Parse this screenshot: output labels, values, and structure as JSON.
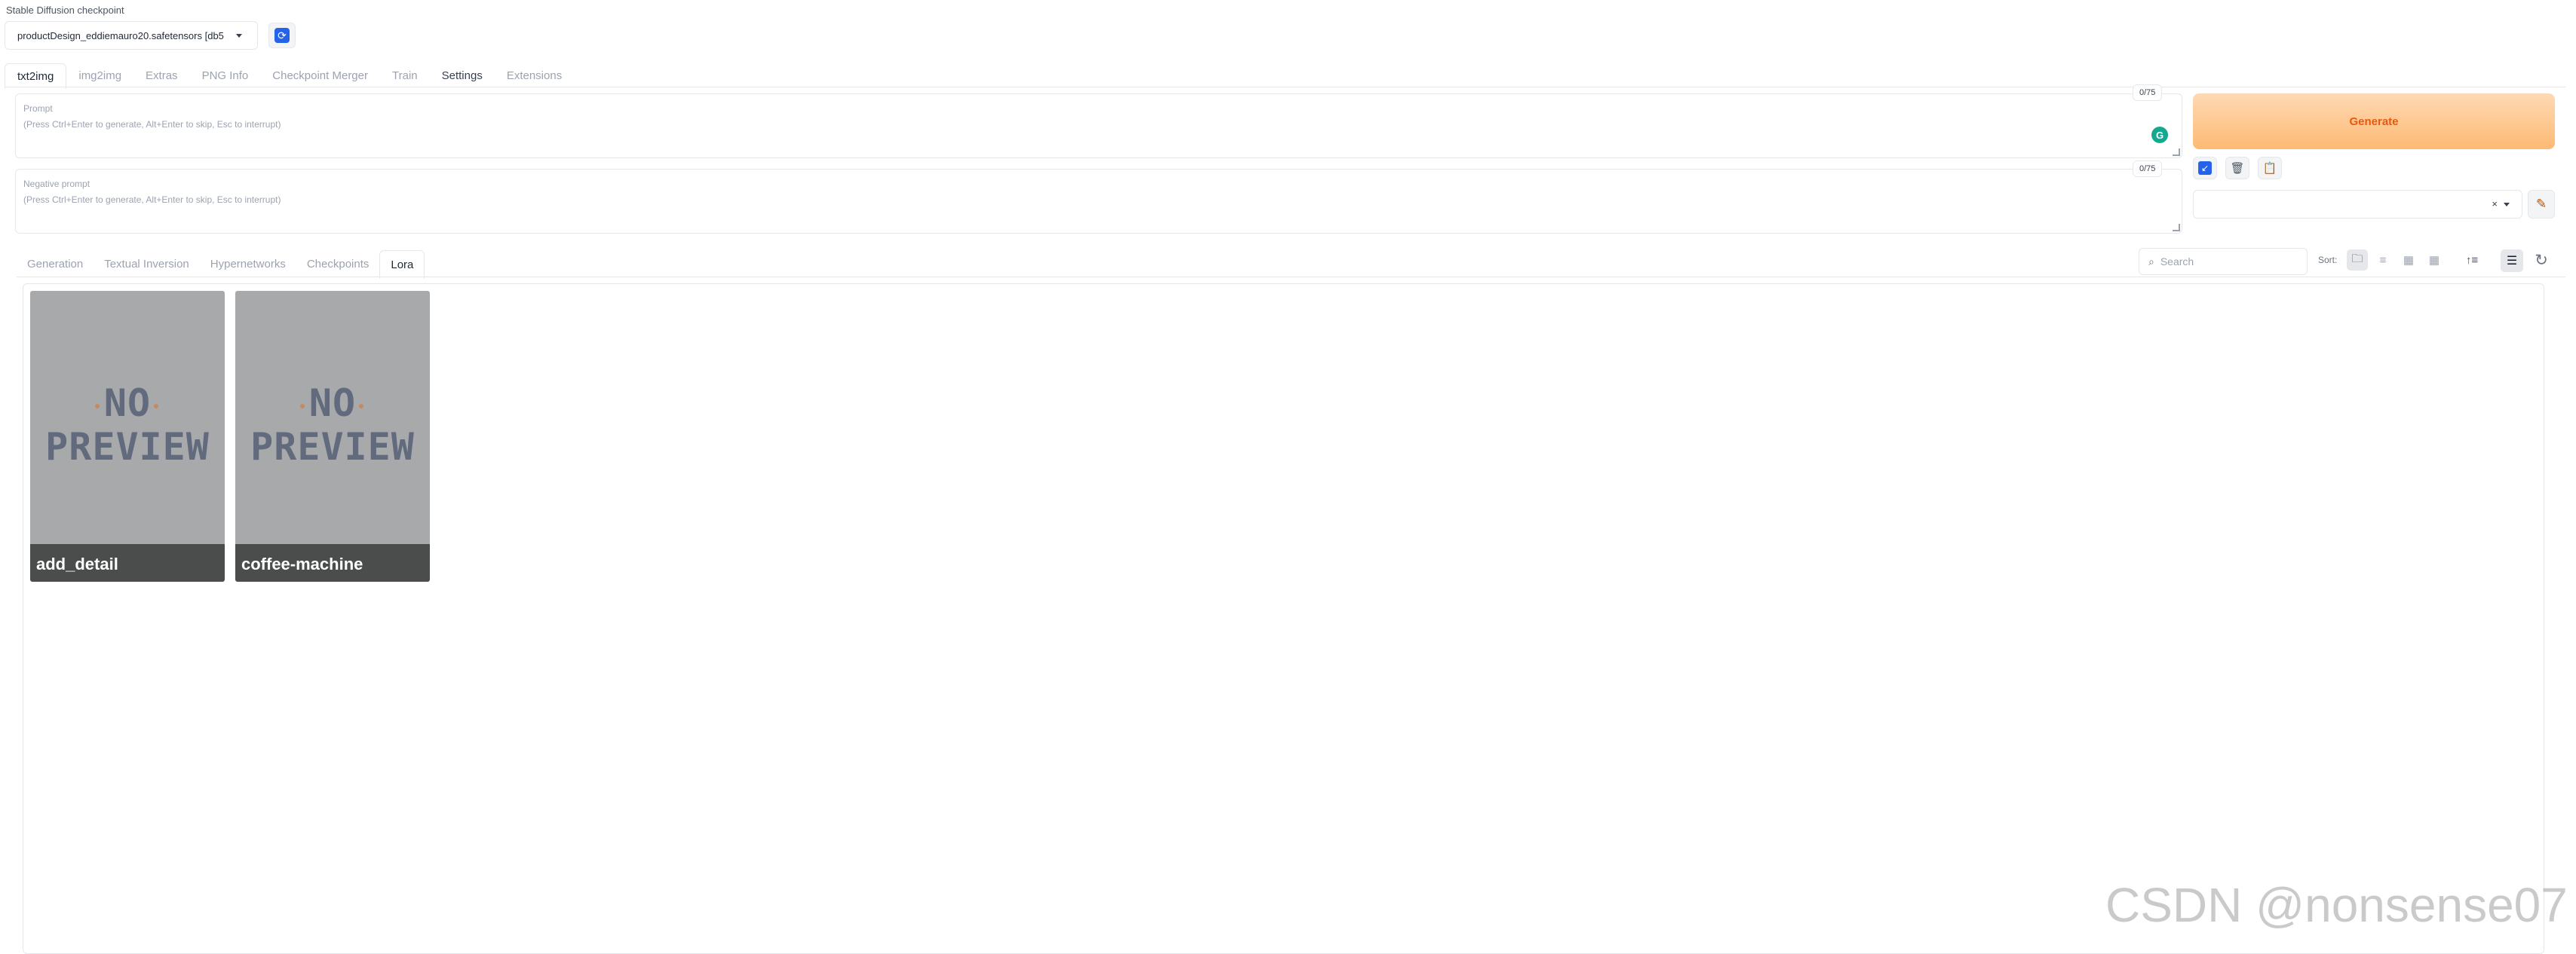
{
  "checkpoint": {
    "label": "Stable Diffusion checkpoint",
    "value": "productDesign_eddiemauro20.safetensors [db5"
  },
  "top_tabs": [
    {
      "label": "txt2img",
      "selected": true
    },
    {
      "label": "img2img"
    },
    {
      "label": "Extras"
    },
    {
      "label": "PNG Info"
    },
    {
      "label": "Checkpoint Merger"
    },
    {
      "label": "Train"
    },
    {
      "label": "Settings"
    },
    {
      "label": "Extensions"
    }
  ],
  "prompt": {
    "label": "Prompt",
    "placeholder": "(Press Ctrl+Enter to generate, Alt+Enter to skip, Esc to interrupt)",
    "token_count": "0/75"
  },
  "negative_prompt": {
    "label": "Negative prompt",
    "placeholder": "(Press Ctrl+Enter to generate, Alt+Enter to skip, Esc to interrupt)",
    "token_count": "0/75"
  },
  "generate": {
    "label": "Generate"
  },
  "sub_tabs": [
    {
      "label": "Generation"
    },
    {
      "label": "Textual Inversion"
    },
    {
      "label": "Hypernetworks"
    },
    {
      "label": "Checkpoints"
    },
    {
      "label": "Lora",
      "selected": true
    }
  ],
  "search": {
    "placeholder": "Search"
  },
  "sort": {
    "label": "Sort:"
  },
  "cards": [
    {
      "name": "add_detail",
      "preview_line1": "NO",
      "preview_line2": "PREVIEW"
    },
    {
      "name": "coffee-machine",
      "preview_line1": "NO",
      "preview_line2": "PREVIEW"
    }
  ],
  "watermark": "CSDN @nonsense07",
  "colors": {
    "accent": "#2563eb",
    "generate_text": "#ea580c",
    "generate_bg": "#fdba74",
    "card_bg": "#a7a9ab"
  }
}
